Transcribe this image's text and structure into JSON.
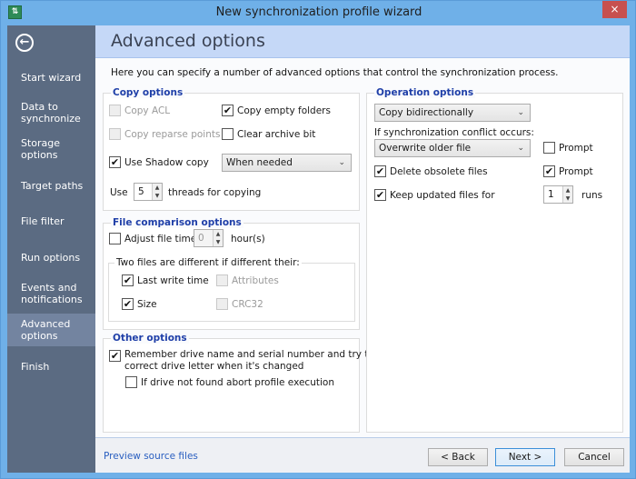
{
  "window": {
    "title": "New synchronization profile wizard",
    "app_icon": "sync-arrows-icon",
    "close_label": "×"
  },
  "sidebar": {
    "back_icon": "←",
    "items": [
      {
        "label": "Start wizard"
      },
      {
        "label": "Data to synchronize"
      },
      {
        "label": "Storage options"
      },
      {
        "label": "Target paths"
      },
      {
        "label": "File filter"
      },
      {
        "label": "Run options"
      },
      {
        "label": "Events and notifications"
      },
      {
        "label": "Advanced options",
        "active": true
      },
      {
        "label": "Finish"
      }
    ]
  },
  "header": {
    "title": "Advanced options"
  },
  "description": "Here you can specify a number of advanced options that control the synchronization process.",
  "copy_options": {
    "title": "Copy options",
    "copy_acl": {
      "label": "Copy ACL",
      "checked": false,
      "disabled": true
    },
    "copy_empty_folders": {
      "label": "Copy empty folders",
      "checked": true
    },
    "copy_reparse_points": {
      "label": "Copy reparse points",
      "checked": false,
      "disabled": true
    },
    "clear_archive_bit": {
      "label": "Clear archive bit",
      "checked": false
    },
    "use_shadow_copy": {
      "label": "Use Shadow copy",
      "checked": true
    },
    "shadow_mode": "When needed",
    "threads_prefix": "Use",
    "threads_value": "5",
    "threads_suffix": "threads for copying"
  },
  "file_comparison": {
    "title": "File comparison options",
    "adjust_file_time": {
      "label": "Adjust file time",
      "checked": false
    },
    "hours_value": "0",
    "hours_suffix": "hour(s)",
    "diff_title": "Two files are different if different their:",
    "last_write_time": {
      "label": "Last write time",
      "checked": true
    },
    "attributes": {
      "label": "Attributes",
      "checked": false,
      "disabled": true
    },
    "size": {
      "label": "Size",
      "checked": true
    },
    "crc32": {
      "label": "CRC32",
      "checked": false,
      "disabled": true
    }
  },
  "other_options": {
    "title": "Other options",
    "remember_drive": {
      "label_line1": "Remember drive name and serial number and try to",
      "label_line2": "correct drive letter when it's changed",
      "checked": true
    },
    "abort_if_not_found": {
      "label": "If drive not found abort profile execution",
      "checked": false
    }
  },
  "operation_options": {
    "title": "Operation options",
    "direction": "Copy bidirectionally",
    "conflict_label": "If synchronization conflict occurs:",
    "conflict_action": "Overwrite older file",
    "conflict_prompt": {
      "label": "Prompt",
      "checked": false
    },
    "delete_obsolete": {
      "label": "Delete obsolete files",
      "checked": true
    },
    "delete_prompt": {
      "label": "Prompt",
      "checked": true
    },
    "keep_updated": {
      "label": "Keep updated files for",
      "checked": true
    },
    "runs_value": "1",
    "runs_suffix": "runs"
  },
  "footer": {
    "preview_link": "Preview source files",
    "back": "< Back",
    "next": "Next >",
    "cancel": "Cancel"
  },
  "glyphs": {
    "check": "✔",
    "chevron": "⌄",
    "up": "▲",
    "down": "▼"
  }
}
